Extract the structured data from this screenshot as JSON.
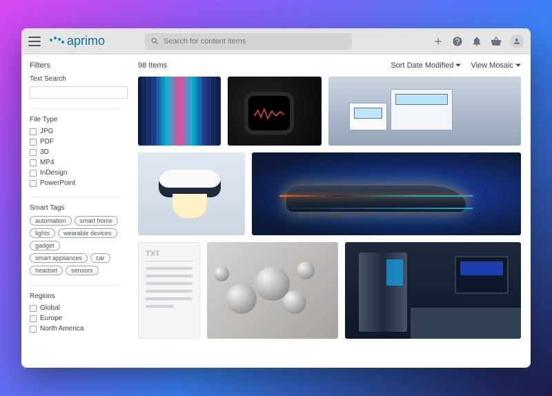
{
  "brand": "aprimo",
  "search": {
    "placeholder": "Search for content items"
  },
  "sidebar": {
    "filters_title": "Filters",
    "text_search_label": "Text Search",
    "file_type_label": "File Type",
    "file_types": [
      "JPG",
      "PDF",
      "3D",
      "MP4",
      "InDesign",
      "PowerPoint"
    ],
    "smart_tags_label": "Smart Tags",
    "tags": [
      "automation",
      "smart home",
      "lights",
      "wearable devices",
      "gadget",
      "smart appliances",
      "car",
      "headset",
      "sensors"
    ],
    "regions_label": "Regions",
    "regions": [
      "Global",
      "Europe",
      "North America"
    ]
  },
  "main": {
    "count_label": "98 Items",
    "sort_label": "Sort Date Modified",
    "view_label": "View Mosaic",
    "txt_tile_label": "TXT"
  }
}
